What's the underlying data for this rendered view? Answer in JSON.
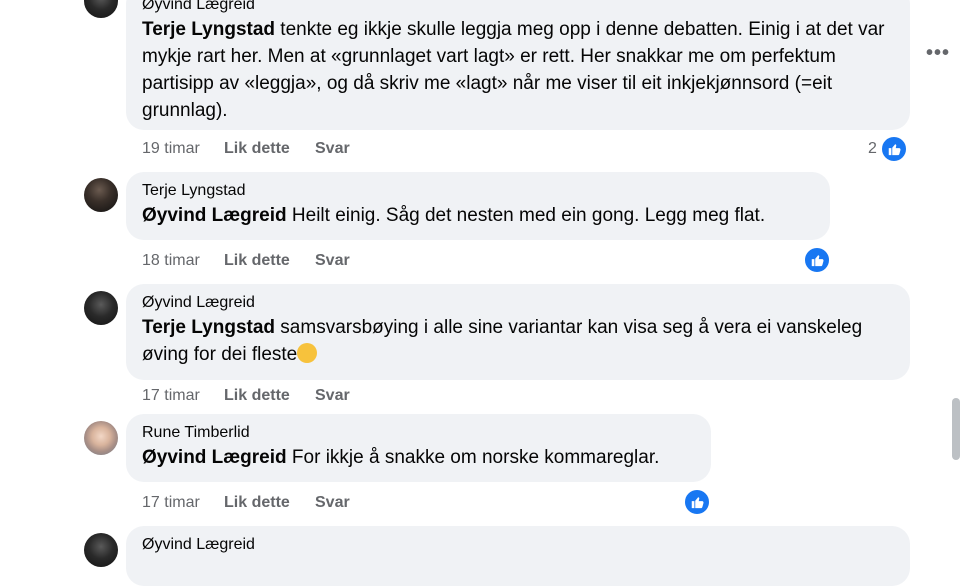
{
  "more_label": "•••",
  "comments": [
    {
      "author": "Øyvind Lægreid",
      "mention": "Terje Lyngstad",
      "text": " tenkte eg ikkje skulle leggja meg opp i denne debatten. Einig i at det var mykje rart her. Men at «grunnlaget vart lagt» er rett. Her snakkar me om perfektum partisipp av «leggja», og då skriv me «lagt» når me viser til eit inkjekjønnsord (=eit grunnlag).",
      "time": "19 timar",
      "like": "Lik dette",
      "reply": "Svar",
      "like_count": "2"
    },
    {
      "author": "Terje Lyngstad",
      "mention": "Øyvind Lægreid",
      "text": " Heilt einig. Såg det nesten med ein gong. Legg meg flat.",
      "time": "18 timar",
      "like": "Lik dette",
      "reply": "Svar"
    },
    {
      "author": "Øyvind Lægreid",
      "mention": "Terje Lyngstad",
      "text": " samsvarsbøying i alle sine variantar kan visa seg å vera ei vanskeleg øving for dei fleste",
      "time": "17 timar",
      "like": "Lik dette",
      "reply": "Svar"
    },
    {
      "author": "Rune Timberlid",
      "mention": "Øyvind Lægreid",
      "text": " For ikkje å snakke om norske kommareglar.",
      "time": "17 timar",
      "like": "Lik dette",
      "reply": "Svar"
    },
    {
      "author": "Øyvind Lægreid"
    }
  ],
  "colors": {
    "bubble": "#f0f2f5",
    "like_blue": "#1877f2",
    "meta_gray": "#65676b"
  }
}
